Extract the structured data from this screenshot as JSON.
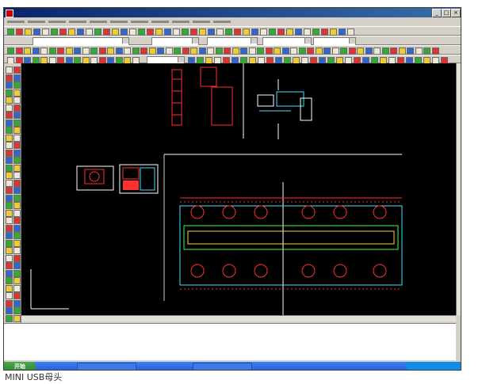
{
  "caption_bottom": "MINI USB母头",
  "taskbar": {
    "start_label": "开始"
  },
  "colors": {
    "drawing_bg": "#000000",
    "title_bar": "#0a246a",
    "accent_red": "#ff3030",
    "accent_cyan": "#40e0ff",
    "accent_green": "#40ff40"
  },
  "icons": {
    "app": "autocad-app-icon",
    "minimize": "minimize-icon",
    "maximize": "maximize-icon",
    "close": "close-icon"
  }
}
